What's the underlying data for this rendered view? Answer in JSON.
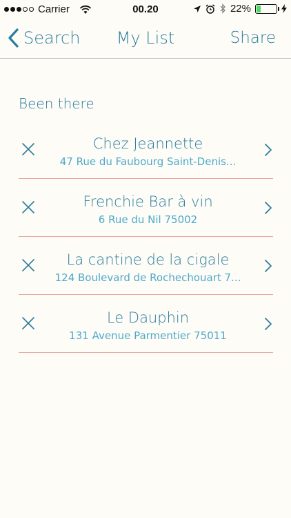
{
  "status_bar": {
    "carrier": "Carrier",
    "time": "00.20",
    "battery_percent": "22%",
    "battery_level": 0.22,
    "icons": [
      "signal-icon",
      "wifi-icon",
      "location-arrow-icon",
      "alarm-icon",
      "bluetooth-icon",
      "battery-icon",
      "charging-icon"
    ]
  },
  "nav": {
    "back_label": "Search",
    "title": "My List",
    "share_label": "Share"
  },
  "section": {
    "title": "Been there"
  },
  "items": [
    {
      "name": "Chez Jeannette",
      "address": "47 Rue du Faubourg Saint-Denis..."
    },
    {
      "name": "Frenchie Bar à vin",
      "address": "6 Rue du Nil 75002"
    },
    {
      "name": "La cantine de la cigale",
      "address": "124 Boulevard de Rochechouart 7..."
    },
    {
      "name": "Le Dauphin",
      "address": "131 Avenue Parmentier 75011"
    }
  ],
  "colors": {
    "accent": "#2a7c9c",
    "address": "#4da9cb",
    "divider": "#e8a394",
    "background": "#fdfcf7",
    "battery": "#4cd964"
  }
}
